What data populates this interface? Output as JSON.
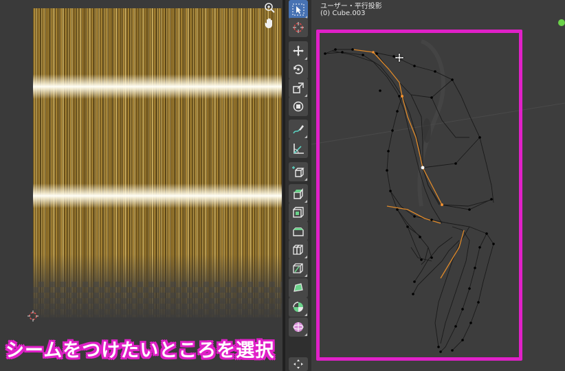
{
  "viewport": {
    "view_label": "ユーザー・平行投影",
    "object_label": "(0) Cube.003"
  },
  "uv_editor": {
    "texture": "hair-strands-texture",
    "zoom_icon": "zoom-icon",
    "pan_icon": "hand-pan-icon"
  },
  "toolbar": {
    "tools": [
      {
        "name": "select-tool",
        "icon": "cursor-arrow-icon",
        "active": true
      },
      {
        "name": "cursor-tool",
        "icon": "3d-cursor-icon",
        "active": false
      },
      {
        "name": "move-tool",
        "icon": "move-arrows-icon",
        "active": false
      },
      {
        "name": "rotate-tool",
        "icon": "rotate-icon",
        "active": false
      },
      {
        "name": "scale-tool",
        "icon": "scale-icon",
        "active": false
      },
      {
        "name": "transform-tool",
        "icon": "transform-icon",
        "active": false
      },
      {
        "name": "annotate-tool",
        "icon": "annotate-pen-icon",
        "active": false
      },
      {
        "name": "measure-tool",
        "icon": "ruler-icon",
        "active": false
      },
      {
        "name": "add-cube-tool",
        "icon": "add-cube-icon",
        "active": false
      },
      {
        "name": "extrude-tool",
        "icon": "extrude-icon",
        "active": false
      },
      {
        "name": "inset-tool",
        "icon": "inset-faces-icon",
        "active": false
      },
      {
        "name": "bevel-tool",
        "icon": "bevel-icon",
        "active": false
      },
      {
        "name": "loop-cut-tool",
        "icon": "loop-cut-icon",
        "active": false
      },
      {
        "name": "knife-tool",
        "icon": "knife-icon",
        "active": false
      },
      {
        "name": "poly-build-tool",
        "icon": "poly-build-icon",
        "active": false
      },
      {
        "name": "spin-tool",
        "icon": "spin-icon",
        "active": false
      },
      {
        "name": "smooth-tool",
        "icon": "smooth-sphere-icon",
        "active": false
      }
    ]
  },
  "colors": {
    "highlight": "#e020c8",
    "selected_edge": "#e08a2a",
    "active_tool": "#4772b3"
  },
  "caption": {
    "text": "シームをつけたいところを選択"
  }
}
